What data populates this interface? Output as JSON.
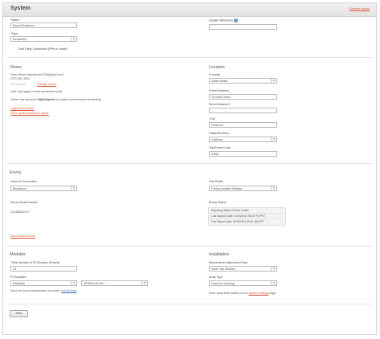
{
  "header": {
    "title": "System",
    "top_link": "System status"
  },
  "system": {
    "name_label": "*Name",
    "name_value": "Brown Residence",
    "type_label": "*Type",
    "type_value": "Residential",
    "third_party_text": "Third Party Connection (PPA or Lease)",
    "installer_ref_label": "Installer Reference",
    "installer_ref_value": ""
  },
  "owner": {
    "section_title": "Owner",
    "name": "Dave Brown (davebrown123@gmail.com)",
    "phone": "(707) 681-5911",
    "badge": "Not verified",
    "change_owner": "Change Owner",
    "logged_in_text": "User has logged in and connected email",
    "access_text_pre": "Owner has access to ",
    "access_app": "MyEnlighten",
    "access_text_post": " for system performance monitoring.",
    "link1": "Login Dave Brown",
    "link2": "Send system access to owner"
  },
  "location": {
    "section_title": "Location",
    "country_label": "*Country",
    "country_value": "United States",
    "street_label": "*Street Address",
    "street_value": "110 Main Street",
    "street2_label": "Street Address 2",
    "street2_value": "",
    "city_label": "*City",
    "city_value": "Petaluma",
    "state_label": "*State/Province",
    "state_value": "California",
    "zip_label": "*Zip/Postal Code",
    "zip_value": "94954"
  },
  "envoy": {
    "section_title": "Envoy",
    "internet_label": "*Internet Connection",
    "internet_value": "Broadband",
    "serial_label": "Envoy Serial Number",
    "serial_value": "121406002177",
    "add_link": "Add Another Envoy",
    "grid_label": "Grid Profile",
    "grid_value": "Factory Installed Settings",
    "status_label": "Envoy Status",
    "status_rows": [
      "Reporting Status: Device Online",
      "Last Support Date: 01/16/2014 06:10 PM PST",
      "First Report Date: 01/09/2014 09:51 AM PST"
    ]
  },
  "modules": {
    "section_title": "Modules",
    "total_label": "*Total Number of PV Modules (Panels)",
    "total_value": "18",
    "pv_label": "PV Modules",
    "manufacturer_value": "Mitsubishi",
    "model_value": "UF250W-MLE5U",
    "missing_text_pre": "Don't see your manufacturer or model? ",
    "missing_link": "Let us know"
  },
  "installation": {
    "section_title": "Installation",
    "attachment_label": "Microinverter Attachment Type",
    "attachment_value": "Rack / Not Mounted",
    "array_label": "Array Type",
    "array_value": "Fixed (not tracking)",
    "enter_text_pre": "Enter array level details on the ",
    "enter_link": "system settings",
    "enter_text_post": " page."
  },
  "footer": {
    "save_label": "Save"
  }
}
